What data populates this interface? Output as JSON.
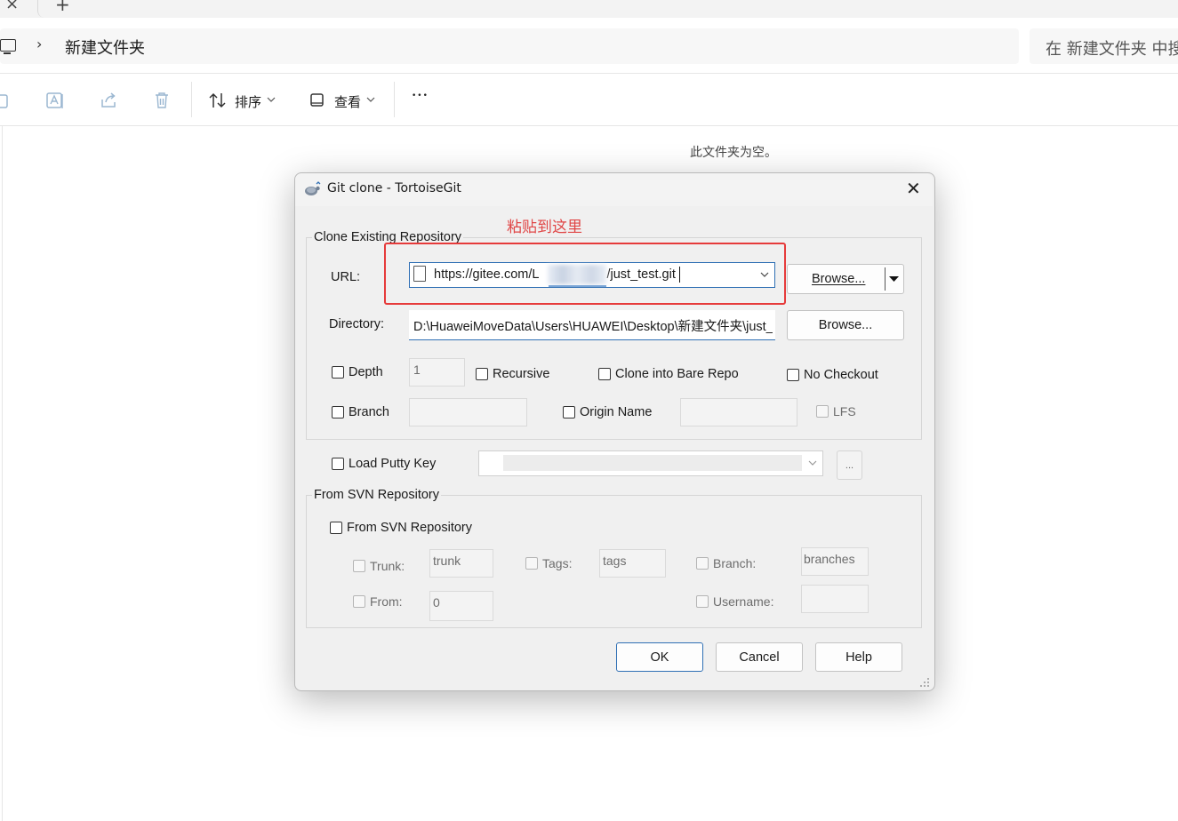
{
  "explorer": {
    "tab_close_glyph": "×",
    "tab_new_glyph": "+",
    "breadcrumb_chevron": "›",
    "breadcrumb": "新建文件夹",
    "search_placeholder": "在 新建文件夹 中搜",
    "toolbar": {
      "sort_label": "排序",
      "view_label": "查看",
      "more_glyph": "•••"
    },
    "empty_message": "此文件夹为空。"
  },
  "annotation": {
    "text": "粘贴到这里",
    "color": "#e63b3b"
  },
  "dialog": {
    "title": "Git clone - TortoiseGit",
    "close_glyph": "✕",
    "clone_group": {
      "legend": "Clone Existing Repository",
      "url_label": "URL:",
      "url_value_prefix": "https://gitee.com/L",
      "url_value_suffix": "/just_test.git",
      "browse_url_label": "Browse...",
      "directory_label": "Directory:",
      "directory_value": "D:\\HuaweiMoveData\\Users\\HUAWEI\\Desktop\\新建文件夹\\just_test",
      "browse_dir_label": "Browse...",
      "depth_label": "Depth",
      "depth_value": "1",
      "recursive_label": "Recursive",
      "bare_repo_label": "Clone into Bare Repo",
      "no_checkout_label": "No Checkout",
      "branch_label": "Branch",
      "origin_name_label": "Origin Name",
      "lfs_label": "LFS"
    },
    "putty": {
      "label": "Load Putty Key",
      "more_label": "..."
    },
    "svn_group": {
      "legend": "From SVN Repository",
      "checkbox_label": "From SVN Repository",
      "trunk_label": "Trunk:",
      "trunk_value": "trunk",
      "tags_label": "Tags:",
      "tags_value": "tags",
      "branch_label": "Branch:",
      "branch_value": "branches",
      "from_label": "From:",
      "from_value": "0",
      "username_label": "Username:"
    },
    "buttons": {
      "ok": "OK",
      "cancel": "Cancel",
      "help": "Help"
    }
  }
}
